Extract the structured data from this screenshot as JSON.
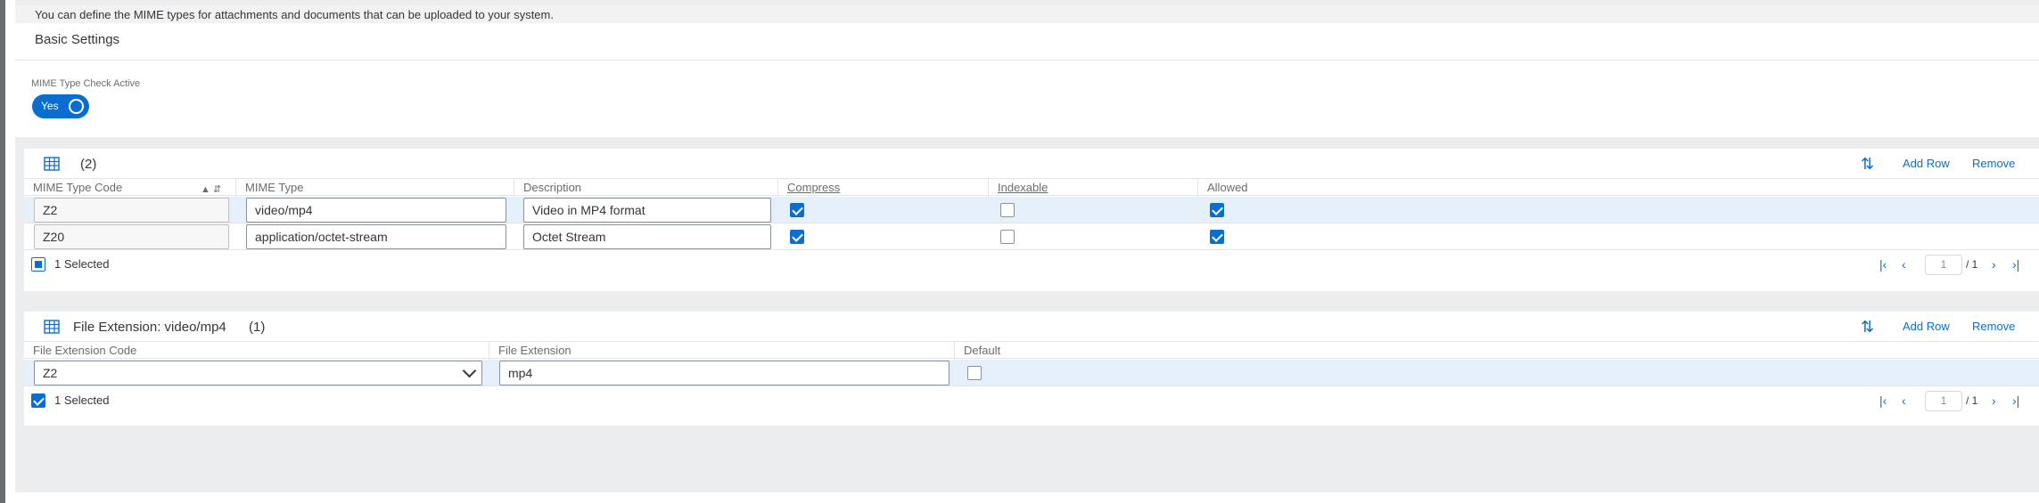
{
  "info_text": "You can define the MIME types for attachments and documents that can be uploaded to your system.",
  "basic": {
    "title": "Basic Settings",
    "mime_check_label": "MIME Type Check Active",
    "switch_label": "Yes"
  },
  "mime_table": {
    "count": "(2)",
    "add_row": "Add Row",
    "remove": "Remove",
    "headers": [
      "MIME Type Code",
      "MIME Type",
      "Description",
      "Compress",
      "Indexable",
      "Allowed"
    ],
    "rows": [
      {
        "code": "Z2",
        "type": "video/mp4",
        "description": "Video in MP4 format",
        "compress": true,
        "indexable": false,
        "allowed": true
      },
      {
        "code": "Z20",
        "type": "application/octet-stream",
        "description": "Octet Stream",
        "compress": true,
        "indexable": false,
        "allowed": true
      }
    ],
    "selected_text": "1 Selected",
    "page": "1",
    "page_total": "/ 1"
  },
  "ext_table": {
    "title": "File Extension: video/mp4",
    "count": "(1)",
    "add_row": "Add Row",
    "remove": "Remove",
    "headers": [
      "File Extension Code",
      "File Extension",
      "Default"
    ],
    "rows": [
      {
        "code": "Z2",
        "extension": "mp4",
        "default": false
      }
    ],
    "selected_text": "1 Selected",
    "page": "1",
    "page_total": "/ 1"
  },
  "colors": {
    "accent": "#0a6ed1",
    "selected_row": "#e5f0fa"
  }
}
